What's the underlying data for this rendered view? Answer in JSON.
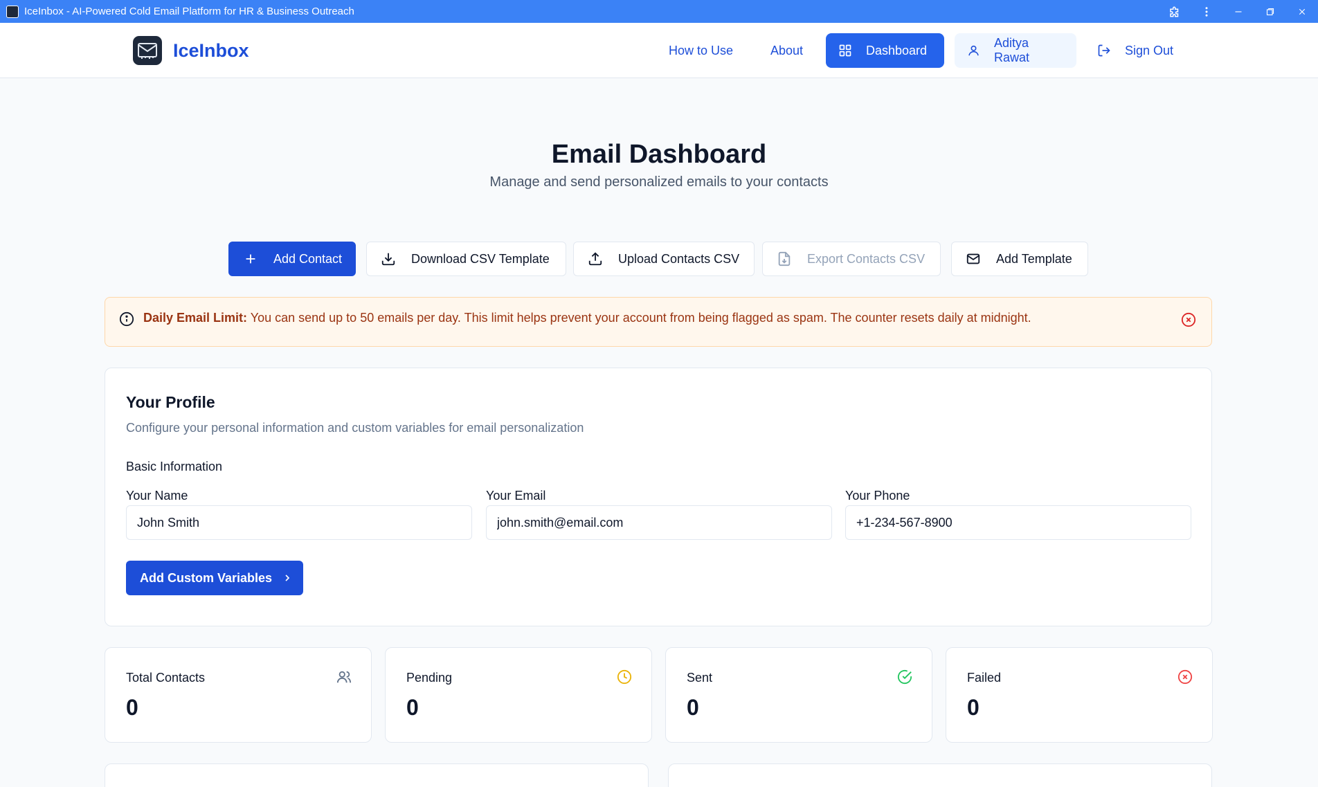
{
  "window": {
    "title": "IceInbox - AI-Powered Cold Email Platform for HR & Business Outreach"
  },
  "nav": {
    "brand": "IceInbox",
    "how_to_use": "How to Use",
    "about": "About",
    "dashboard": "Dashboard",
    "user": "Aditya Rawat",
    "sign_out": "Sign Out"
  },
  "header": {
    "title": "Email Dashboard",
    "subtitle": "Manage and send personalized emails to your contacts"
  },
  "actions": {
    "add_contact": "Add Contact",
    "download_csv": "Download CSV Template",
    "upload_csv": "Upload Contacts CSV",
    "export_csv": "Export Contacts CSV",
    "add_template": "Add Template"
  },
  "alert": {
    "label": "Daily Email Limit:",
    "message": " You can send up to 50 emails per day. This limit helps prevent your account from being flagged as spam. The counter resets daily at midnight."
  },
  "profile": {
    "title": "Your Profile",
    "description": "Configure your personal information and custom variables for email personalization",
    "section": "Basic Information",
    "name_label": "Your Name",
    "name_value": "John Smith",
    "email_label": "Your Email",
    "email_value": "john.smith@email.com",
    "phone_label": "Your Phone",
    "phone_value": "+1-234-567-8900",
    "custom_vars_button": "Add Custom Variables"
  },
  "stats": {
    "total": {
      "label": "Total Contacts",
      "value": "0",
      "icon": "users-icon"
    },
    "pending": {
      "label": "Pending",
      "value": "0",
      "icon": "clock-icon"
    },
    "sent": {
      "label": "Sent",
      "value": "0",
      "icon": "check-circle-icon"
    },
    "failed": {
      "label": "Failed",
      "value": "0",
      "icon": "x-circle-icon"
    }
  },
  "colors": {
    "accent": "#1d4ed8",
    "titlebar": "#3b82f6",
    "pending": "#eab308",
    "sent": "#22c55e",
    "failed": "#ef4444",
    "alert_text": "#9a3412"
  }
}
